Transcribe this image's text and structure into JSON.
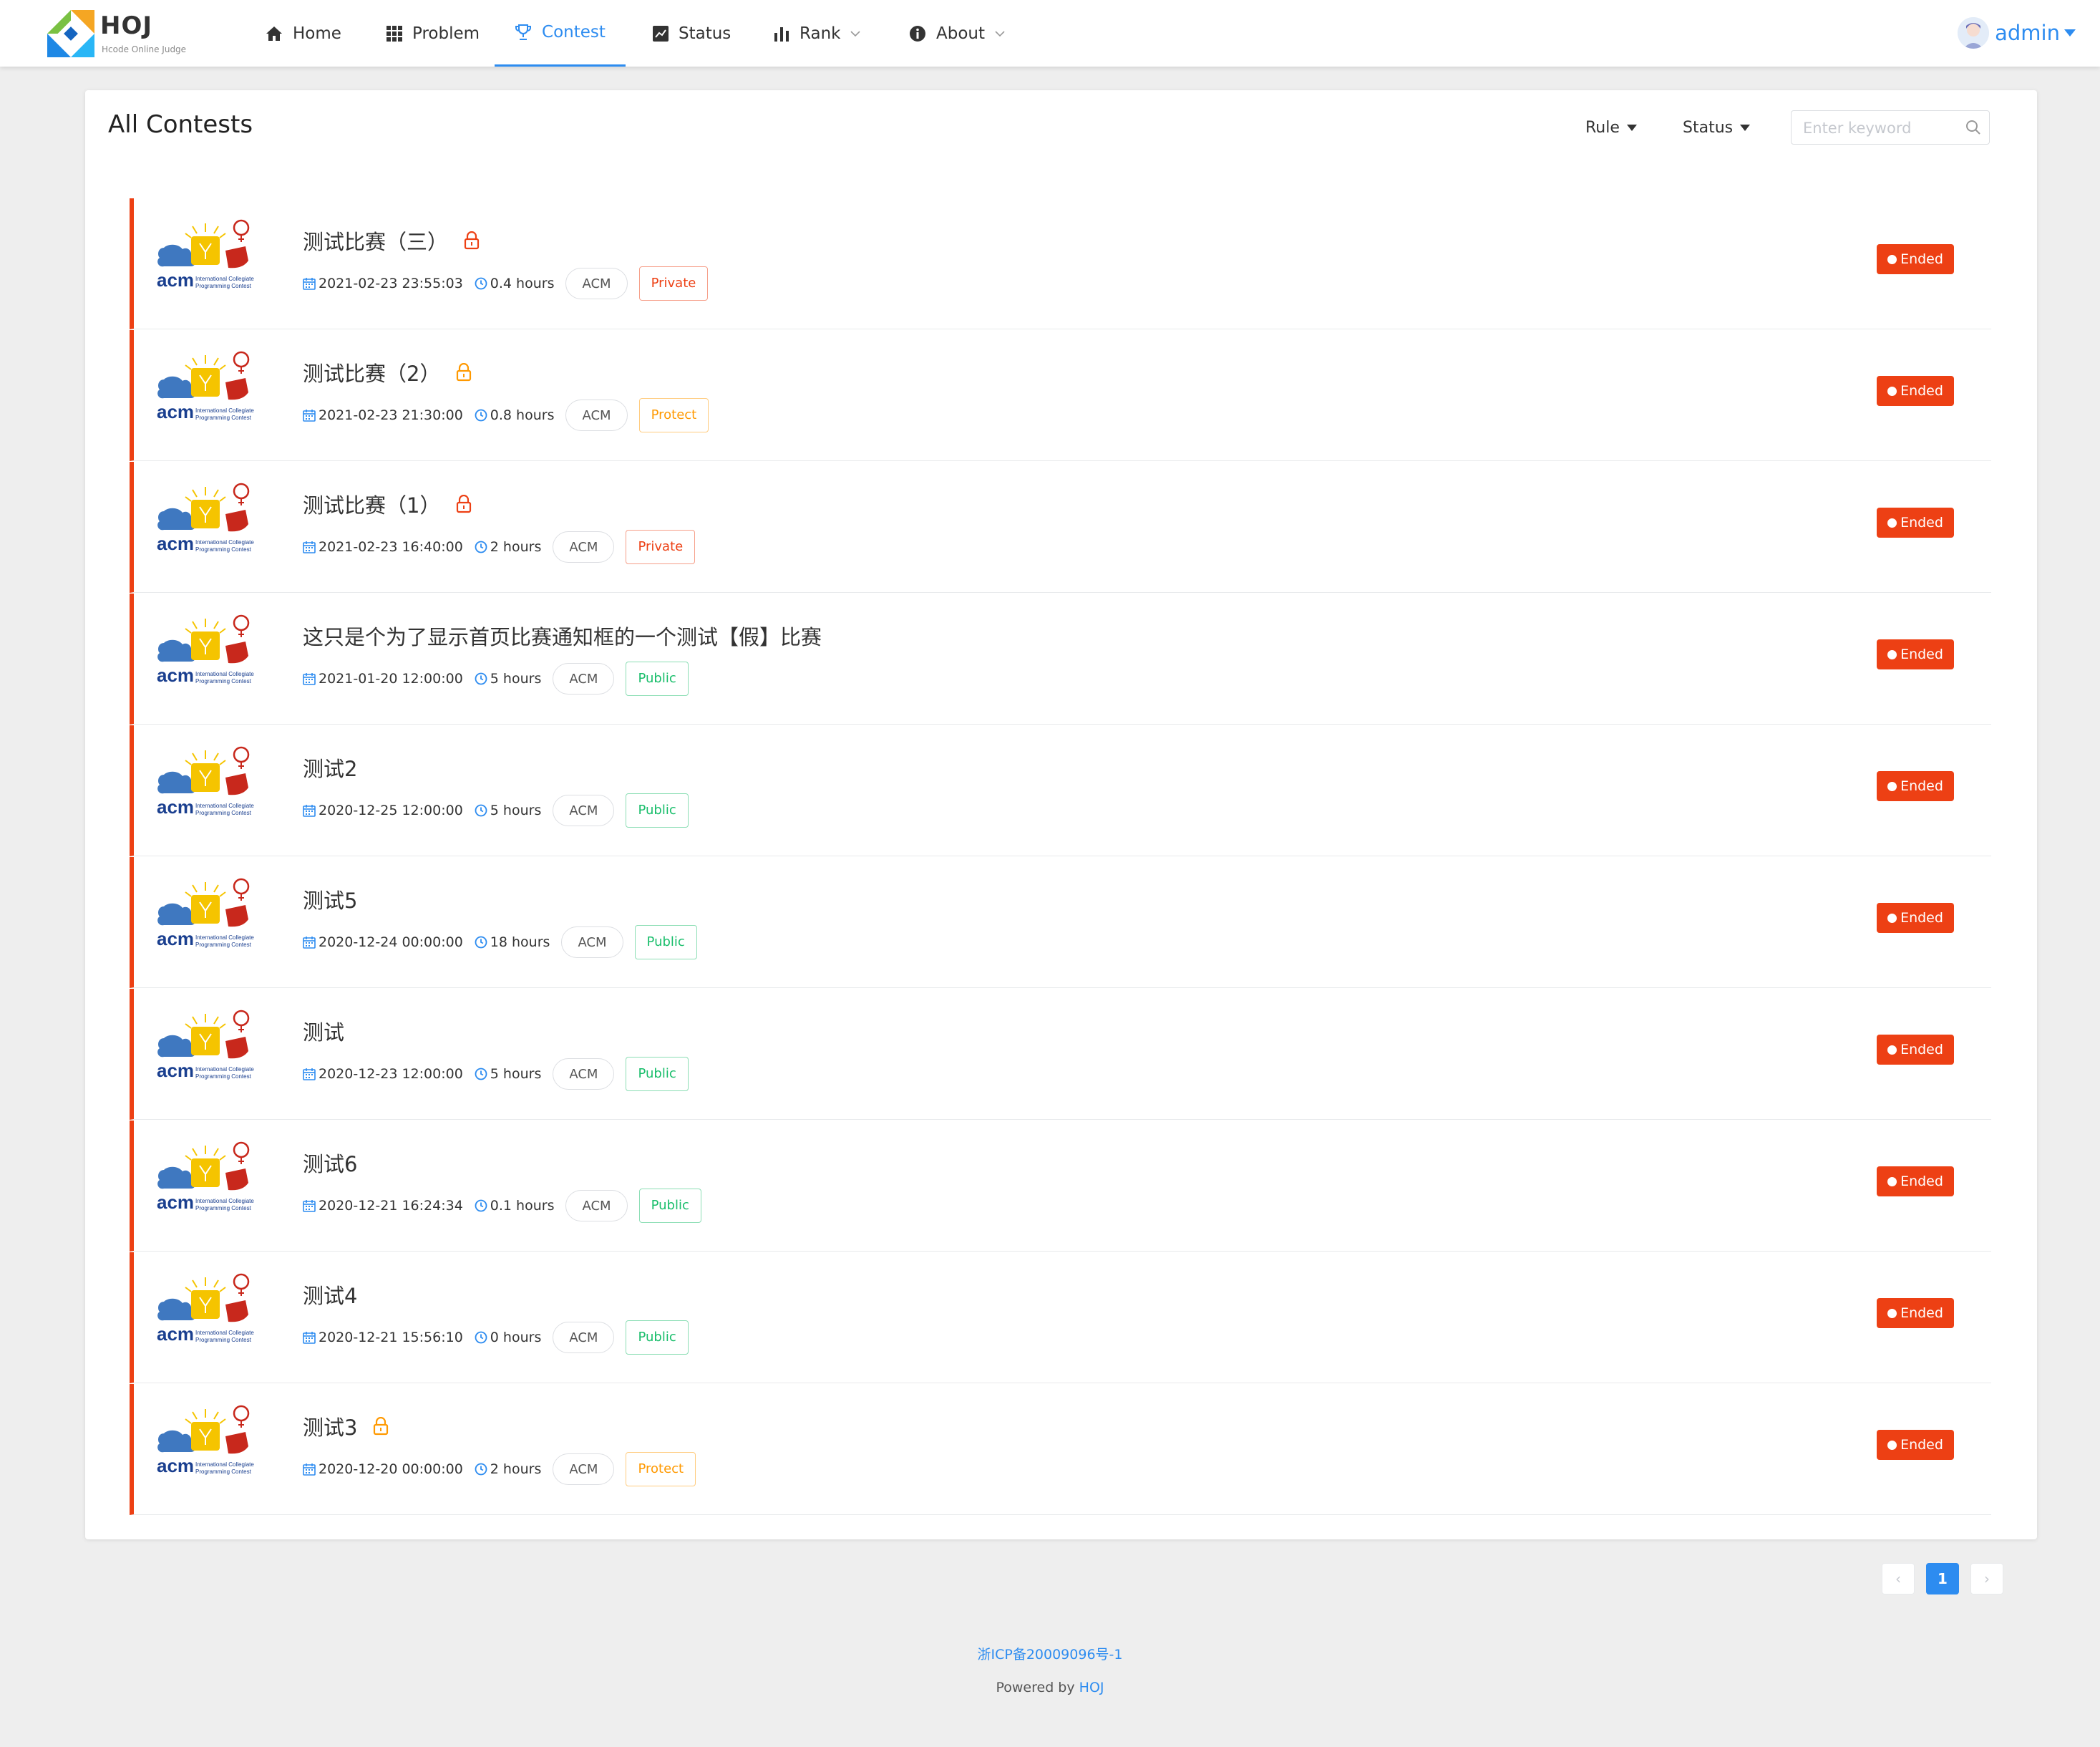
{
  "app": {
    "name": "HOJ",
    "subtitle": "Hcode Online Judge"
  },
  "nav": {
    "home": "Home",
    "problem": "Problem",
    "contest": "Contest",
    "status": "Status",
    "rank": "Rank",
    "about": "About"
  },
  "user": {
    "name": "admin"
  },
  "page": {
    "title": "All Contests",
    "filter_rule": "Rule",
    "filter_status": "Status",
    "search_placeholder": "Enter keyword"
  },
  "contests": [
    {
      "title": "测试比赛（三）",
      "start": "2021-02-23 23:55:03",
      "duration": "0.4 hours",
      "rule": "ACM",
      "auth": "Private",
      "status": "Ended",
      "lock": "private"
    },
    {
      "title": "测试比赛（2）",
      "start": "2021-02-23 21:30:00",
      "duration": "0.8 hours",
      "rule": "ACM",
      "auth": "Protect",
      "status": "Ended",
      "lock": "protect"
    },
    {
      "title": "测试比赛（1）",
      "start": "2021-02-23 16:40:00",
      "duration": "2 hours",
      "rule": "ACM",
      "auth": "Private",
      "status": "Ended",
      "lock": "private"
    },
    {
      "title": "这只是个为了显示首页比赛通知框的一个测试【假】比赛",
      "start": "2021-01-20 12:00:00",
      "duration": "5 hours",
      "rule": "ACM",
      "auth": "Public",
      "status": "Ended",
      "lock": "none"
    },
    {
      "title": "测试2",
      "start": "2020-12-25 12:00:00",
      "duration": "5 hours",
      "rule": "ACM",
      "auth": "Public",
      "status": "Ended",
      "lock": "none"
    },
    {
      "title": "测试5",
      "start": "2020-12-24 00:00:00",
      "duration": "18 hours",
      "rule": "ACM",
      "auth": "Public",
      "status": "Ended",
      "lock": "none"
    },
    {
      "title": "测试",
      "start": "2020-12-23 12:00:00",
      "duration": "5 hours",
      "rule": "ACM",
      "auth": "Public",
      "status": "Ended",
      "lock": "none"
    },
    {
      "title": "测试6",
      "start": "2020-12-21 16:24:34",
      "duration": "0.1 hours",
      "rule": "ACM",
      "auth": "Public",
      "status": "Ended",
      "lock": "none"
    },
    {
      "title": "测试4",
      "start": "2020-12-21 15:56:10",
      "duration": "0 hours",
      "rule": "ACM",
      "auth": "Public",
      "status": "Ended",
      "lock": "none"
    },
    {
      "title": "测试3",
      "start": "2020-12-20 00:00:00",
      "duration": "2 hours",
      "rule": "ACM",
      "auth": "Protect",
      "status": "Ended",
      "lock": "protect"
    }
  ],
  "acm_logo": {
    "word": "acm",
    "line1": "International Collegiate",
    "line2": "Programming Contest"
  },
  "pagination": {
    "prev": "‹",
    "current": "1",
    "next": "›"
  },
  "footer": {
    "icp": "浙ICP备20009096号-1",
    "powered_prefix": "Powered by ",
    "powered_link": "HOJ"
  },
  "colors": {
    "primary": "#2d8cf0",
    "ended": "#ed4014",
    "private": "#ed4014",
    "protect": "#ff9900",
    "public": "#19be6b"
  }
}
